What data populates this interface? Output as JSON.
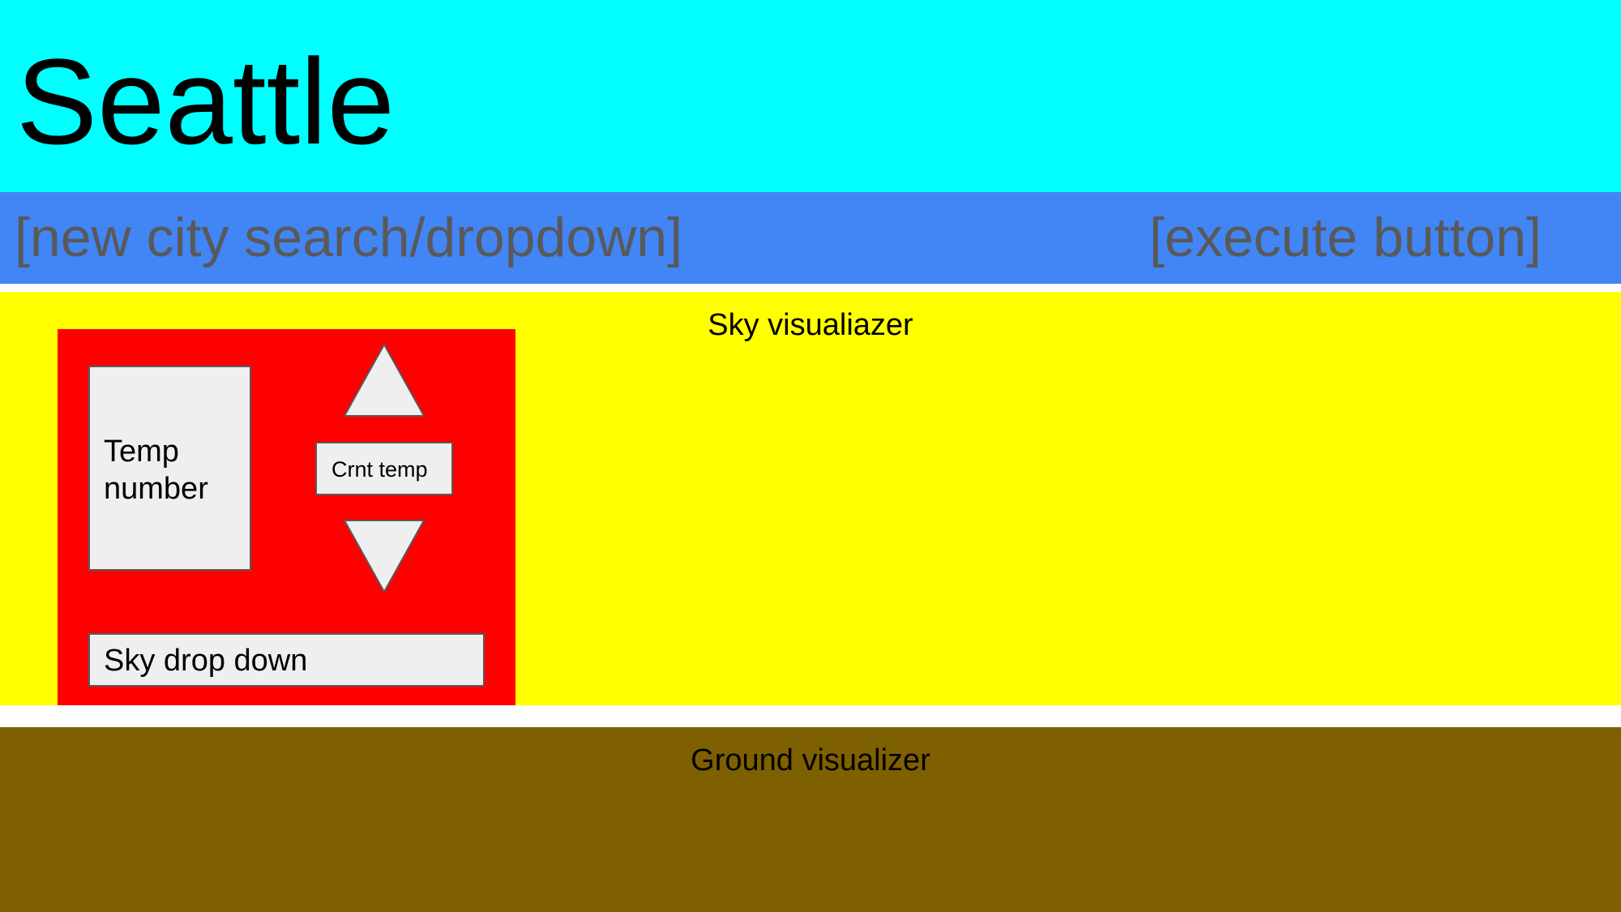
{
  "header": {
    "city_title": "Seattle",
    "background_color": "#00ffff"
  },
  "search_bar": {
    "search_label": "[new city search/dropdown]",
    "execute_label": "[execute button]",
    "background_color": "#4285f4"
  },
  "sky_section": {
    "label": "Sky visualiazer",
    "background_color": "#ffff00",
    "control_panel": {
      "background_color": "#ff0000",
      "temp_number": "Temp number",
      "current_temp": "Crnt temp",
      "increase_icon": "triangle-up-icon",
      "decrease_icon": "triangle-down-icon",
      "sky_dropdown": "Sky drop down"
    }
  },
  "ground_section": {
    "label": "Ground visualizer",
    "background_color": "#7f6000"
  }
}
